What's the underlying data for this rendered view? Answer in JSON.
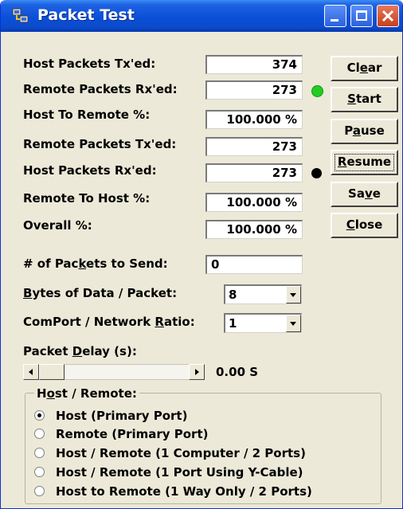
{
  "window": {
    "title": "Packet Test"
  },
  "stats": [
    {
      "label": "Host Packets Tx'ed:",
      "value": "374"
    },
    {
      "label": "Remote Packets Rx'ed:",
      "value": "273"
    },
    {
      "label": "Host To Remote %:",
      "value": "100.000 %"
    },
    {
      "label": "Remote Packets Tx'ed:",
      "value": "273"
    },
    {
      "label": "Host Packets Rx'ed:",
      "value": "273"
    },
    {
      "label": "Remote To Host %:",
      "value": "100.000 %"
    },
    {
      "label": "Overall %:",
      "value": "100.000 %"
    }
  ],
  "indicators": {
    "remote_rx_color": "#22cc22",
    "host_rx_color": "#000000"
  },
  "buttons": [
    {
      "pre": "Cl",
      "ul": "e",
      "post": "ar"
    },
    {
      "pre": "",
      "ul": "S",
      "post": "tart"
    },
    {
      "pre": "P",
      "ul": "a",
      "post": "use"
    },
    {
      "pre": "",
      "ul": "R",
      "post": "esume"
    },
    {
      "pre": "Sa",
      "ul": "v",
      "post": "e"
    },
    {
      "pre": "",
      "ul": "C",
      "post": "lose"
    }
  ],
  "settings": {
    "packets_to_send": {
      "pre": "# of Pac",
      "ul": "k",
      "post": "ets to Send:",
      "value": "0"
    },
    "bytes_per_packet": {
      "pre": "",
      "ul": "B",
      "post": "ytes of Data / Packet:",
      "value": "8"
    },
    "comport_ratio": {
      "pre": "ComPort / Network ",
      "ul": "R",
      "post": "atio:",
      "value": "1"
    },
    "packet_delay": {
      "pre": "Packet ",
      "ul": "D",
      "post": "elay (s):",
      "value": "0.00 S",
      "slider_fraction": 0.0
    }
  },
  "host_remote": {
    "title_pre": "H",
    "title_ul": "o",
    "title_post": "st / Remote:",
    "selected_index": 0,
    "options": [
      "Host (Primary Port)",
      "Remote (Primary Port)",
      "Host / Remote (1 Computer / 2 Ports)",
      "Host / Remote (1 Port Using Y-Cable)",
      "Host to Remote (1 Way Only / 2 Ports)"
    ]
  }
}
